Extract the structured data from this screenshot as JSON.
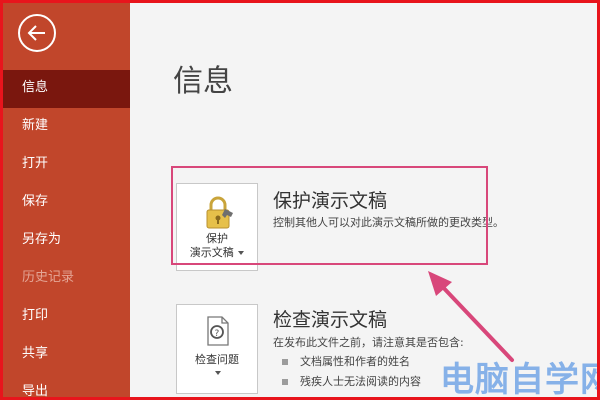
{
  "sidebar": {
    "back_label": "back",
    "items": [
      {
        "label": "信息",
        "active": true
      },
      {
        "label": "新建"
      },
      {
        "label": "打开"
      },
      {
        "label": "保存"
      },
      {
        "label": "另存为"
      },
      {
        "label": "历史记录",
        "disabled": true
      },
      {
        "label": "打印"
      },
      {
        "label": "共享"
      },
      {
        "label": "导出"
      }
    ]
  },
  "main": {
    "title": "信息",
    "protect": {
      "button_label_line1": "保护",
      "button_label_line2": "演示文稿",
      "title": "保护演示文稿",
      "description": "控制其他人可以对此演示文稿所做的更改类型。"
    },
    "inspect": {
      "button_label": "检查问题",
      "title": "检查演示文稿",
      "description": "在发布此文件之前，请注意其是否包含:",
      "bullets": [
        "文档属性和作者的姓名",
        "残疾人士无法阅读的内容"
      ]
    }
  },
  "watermark": "电脑自学网",
  "colors": {
    "sidebar": "#c1462b",
    "sidebar_active": "#7a170e",
    "highlight": "#d8477a",
    "frame": "#e8141c"
  },
  "icons": [
    "back-arrow-icon",
    "lock-key-icon",
    "dropdown-caret-icon",
    "inspect-document-icon"
  ]
}
